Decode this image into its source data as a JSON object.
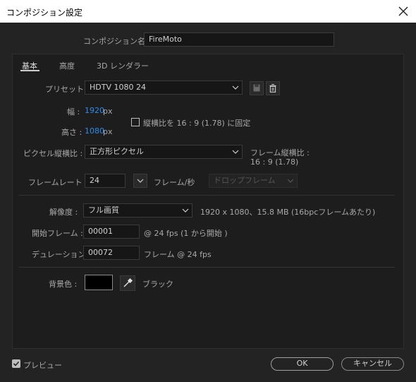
{
  "window": {
    "title": "コンポジション設定"
  },
  "comp_name": {
    "label": "コンポジション名 :",
    "value": "FireMoto"
  },
  "tabs": [
    {
      "label": "基本"
    },
    {
      "label": "高度"
    },
    {
      "label": "3D レンダラー"
    }
  ],
  "preset": {
    "label": "プリセット :",
    "value": "HDTV 1080 24"
  },
  "width": {
    "label": "幅 :",
    "value": "1920",
    "unit": "px"
  },
  "height": {
    "label": "高さ :",
    "value": "1080",
    "unit": "px"
  },
  "lock_aspect": {
    "label": "縦横比を 16 : 9 (1.78) に固定",
    "checked": false
  },
  "pixel_aspect": {
    "label": "ピクセル縦横比 :",
    "value": "正方形ピクセル"
  },
  "frame_aspect": {
    "label": "フレーム縦横比 :",
    "value": "16 : 9 (1.78)"
  },
  "frame_rate": {
    "label": "フレームレート :",
    "value": "24",
    "unit": "フレーム/秒",
    "drop_frame": "ドロップフレーム"
  },
  "resolution": {
    "label": "解像度 :",
    "value": "フル画質",
    "info": "1920 x 1080、15.8 MB (16bpcフレームあたり)"
  },
  "start_frame": {
    "label": "開始フレーム :",
    "value": "00001",
    "info": "@ 24 fps (1 から開始 )"
  },
  "duration": {
    "label": "デュレーション :",
    "value": "00072",
    "info": "フレーム @ 24 fps"
  },
  "bg_color": {
    "label": "背景色 :",
    "name": "ブラック",
    "swatch": "#000000"
  },
  "preview": {
    "label": "プレビュー",
    "checked": true
  },
  "buttons": {
    "ok": "OK",
    "cancel": "キャンセル"
  },
  "colors": {
    "accent": "#2d8ceb",
    "background": "#232323"
  }
}
